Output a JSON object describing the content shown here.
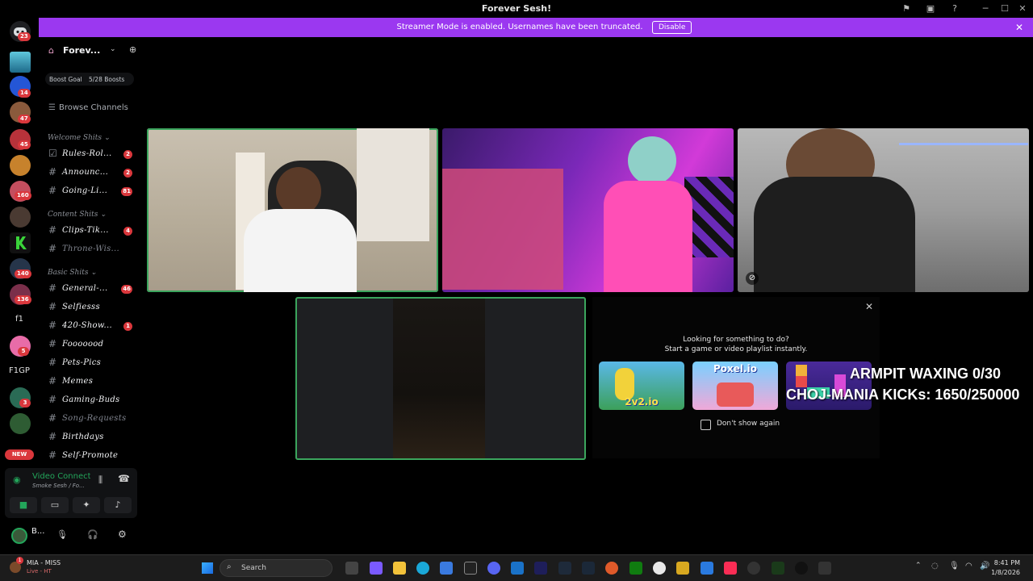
{
  "window": {
    "title": "Forever Sesh!"
  },
  "banner": {
    "text": "Streamer Mode is enabled. Usernames have been truncated.",
    "button": "Disable"
  },
  "guilds": {
    "badges": [
      "23",
      "14",
      "47",
      "45",
      "160",
      "140",
      "136",
      "5",
      "3"
    ],
    "text_items": [
      "f1",
      "F1GP"
    ],
    "new_label": "NEW"
  },
  "server": {
    "name": "Forev...",
    "boost_label": "Boost Goal",
    "boost_count": "5/28 Boosts",
    "browse": "Browse Channels"
  },
  "categories": [
    {
      "name": "Welcome Shits",
      "channels": [
        {
          "name": "Rules-Rol...",
          "badge": "2",
          "muted": false
        },
        {
          "name": "Announc...",
          "badge": "2",
          "muted": false
        },
        {
          "name": "Going-Li...",
          "badge": "81",
          "muted": false
        }
      ]
    },
    {
      "name": "Content Shits",
      "channels": [
        {
          "name": "Clips-Tik...",
          "badge": "4",
          "muted": false
        },
        {
          "name": "Throne-Wis...",
          "badge": "",
          "muted": true
        }
      ]
    },
    {
      "name": "Basic Shits",
      "channels": [
        {
          "name": "General-...",
          "badge": "46",
          "muted": false
        },
        {
          "name": "Selfiesss",
          "badge": "",
          "muted": false
        },
        {
          "name": "420-Show...",
          "badge": "1",
          "muted": false
        },
        {
          "name": "Fooooood",
          "badge": "",
          "muted": false
        },
        {
          "name": "Pets-Pics",
          "badge": "",
          "muted": false
        },
        {
          "name": "Memes",
          "badge": "",
          "muted": false
        },
        {
          "name": "Gaming-Buds",
          "badge": "",
          "muted": false
        },
        {
          "name": "Song-Requests",
          "badge": "",
          "muted": true
        },
        {
          "name": "Birthdays",
          "badge": "",
          "muted": false
        },
        {
          "name": "Self-Promote",
          "badge": "",
          "muted": false
        }
      ]
    }
  ],
  "voice": {
    "status": "Video Connected",
    "channel": "Smoke Sesh / Fo..."
  },
  "user": {
    "name": "B..."
  },
  "activity": {
    "line1": "Looking for something to do?",
    "line2": "Start a game or video playlist instantly.",
    "games": [
      "2v2.io",
      "Poxel.io",
      ""
    ],
    "dont_show": "Don't show again"
  },
  "overlay": {
    "line1": "ARMPIT WAXING 0/30",
    "line2": "CHOJ-MANIA KICKs: 1650/250000"
  },
  "taskbar": {
    "notif_title": "MIA - MISS",
    "notif_sub": "Live - HT",
    "notif_badge": "1",
    "search": "Search",
    "time": "8:41 PM",
    "date": "1/8/2026"
  },
  "colors": {
    "accent": "#9b38f0",
    "online": "#23a55a",
    "badge": "#da373c"
  }
}
